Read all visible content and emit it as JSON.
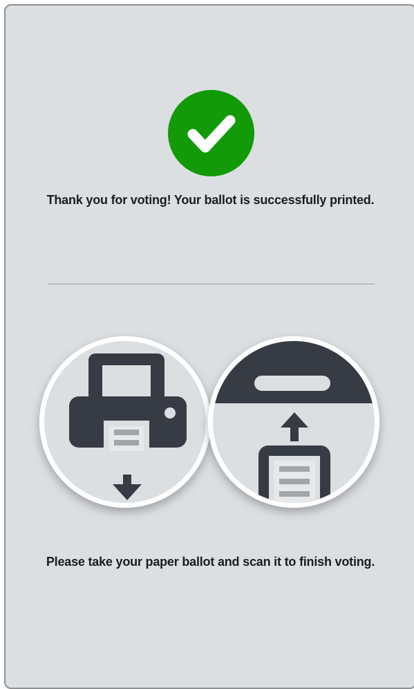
{
  "status": {
    "icon": "checkmark-icon",
    "color": "#129a08"
  },
  "messages": {
    "printed": "Thank you for voting! Your ballot is successfully printed.",
    "instruction": "Please take your paper ballot and scan it to finish voting."
  },
  "illustrations": {
    "left_icon": "printer-icon",
    "right_icon": "scanner-icon"
  }
}
